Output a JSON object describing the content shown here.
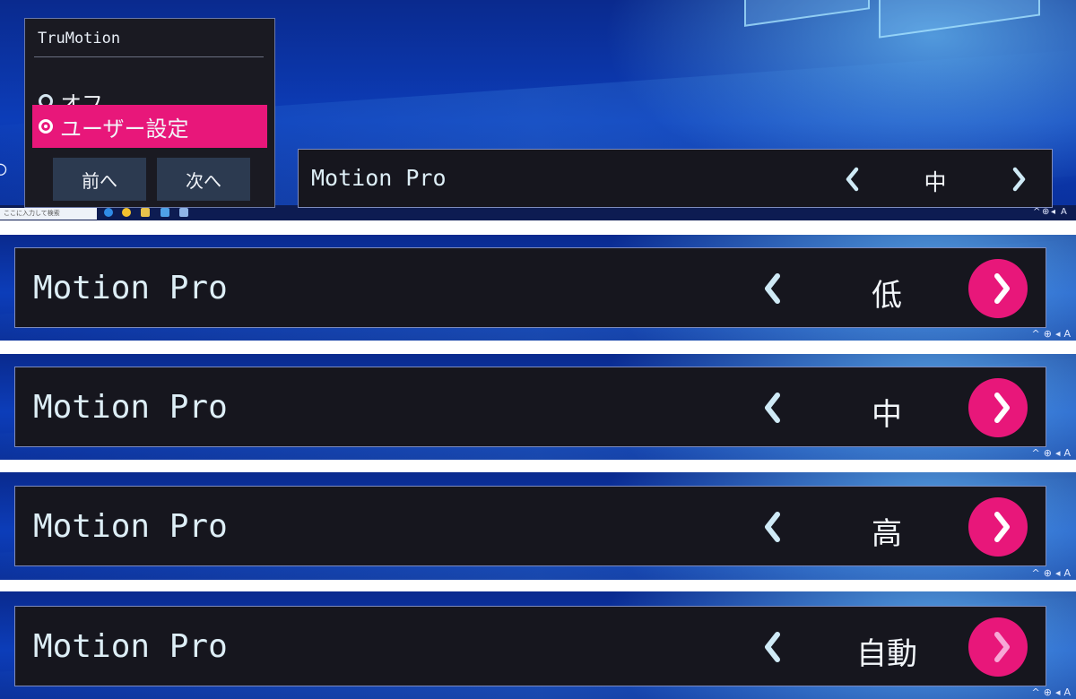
{
  "trumotion_menu": {
    "title": "TruMotion",
    "options": [
      {
        "label": "オフ",
        "selected": false
      },
      {
        "label": "ユーザー設定",
        "selected": true
      }
    ],
    "prev_label": "前へ",
    "next_label": "次へ"
  },
  "taskbar": {
    "search_placeholder": "ここに入力して検索",
    "tray_chevron": "^",
    "tray_ime": "A"
  },
  "motion_pro_bars": [
    {
      "label": "Motion Pro",
      "value": "中"
    },
    {
      "label": "Motion Pro",
      "value": "低"
    },
    {
      "label": "Motion Pro",
      "value": "中"
    },
    {
      "label": "Motion Pro",
      "value": "高"
    },
    {
      "label": "Motion Pro",
      "value": "自動"
    }
  ],
  "colors": {
    "accent_pink": "#e8177a",
    "panel_bg": "#16161e",
    "panel_border": "#7d8bbd",
    "desktop_blue": "#0c3db9"
  }
}
